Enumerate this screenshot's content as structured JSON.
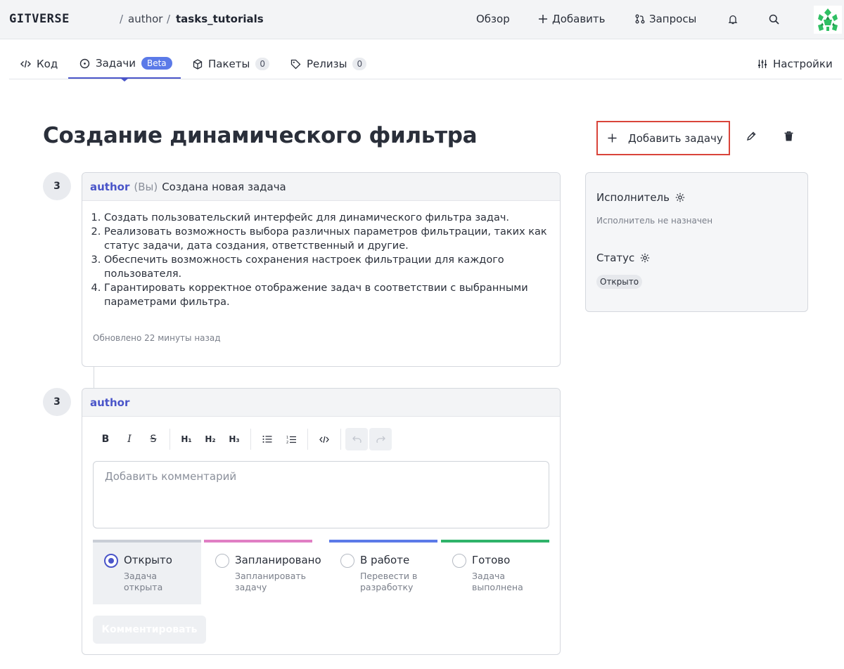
{
  "header": {
    "logo": "GITVERSE",
    "breadcrumb": {
      "owner": "author",
      "repo": "tasks_tutorials",
      "separator": "/"
    },
    "nav": [
      {
        "label": "Обзор",
        "icon": ""
      },
      {
        "label": "Добавить",
        "icon": "plus-icon"
      },
      {
        "label": "Запросы",
        "icon": "pull-request-icon"
      }
    ],
    "icons": [
      "bell-icon",
      "search-icon",
      "avatar"
    ]
  },
  "tabs": [
    {
      "label": "Код",
      "icon": "code-icon"
    },
    {
      "label": "Задачи",
      "icon": "issue-icon",
      "badge": "Beta",
      "active": true
    },
    {
      "label": "Пакеты",
      "icon": "package-icon",
      "badge": "0"
    },
    {
      "label": "Релизы",
      "icon": "tag-icon",
      "badge": "0"
    }
  ],
  "settings_label": "Настройки",
  "issue": {
    "title": "Создание динамического фильтра",
    "add_task_label": "Добавить задачу",
    "first_comment": {
      "step": "3",
      "author": "author",
      "you": "(Вы)",
      "action": "Создана новая задача",
      "items": [
        "Создать пользовательский интерфейс для динамического фильтра задач.",
        "Реализовать возможность выбора различных параметров фильтрации, таких как статус задачи, дата создания, ответственный и другие.",
        "Обеспечить возможность сохранения настроек фильтрации для каждого пользователя.",
        "Гарантировать корректное отображение задач в соответствии с выбранными параметрами фильтра."
      ],
      "updated": "Обновлено 22 минуты назад"
    },
    "new_comment": {
      "step": "3",
      "author": "author",
      "toolbar": [
        "B",
        "I",
        "S",
        "H1",
        "H2",
        "H3",
        "bullet-list",
        "ordered-list",
        "code",
        "undo",
        "redo"
      ],
      "placeholder": "Добавить комментарий",
      "statuses": [
        {
          "name": "Открыто",
          "desc": "Задача открыта",
          "color": "#c9ced6",
          "selected": true
        },
        {
          "name": "Запланировано",
          "desc": "Запланировать задачу",
          "color": "#e07fc4",
          "selected": false
        },
        {
          "name": "В работе",
          "desc": "Перевести в разработку",
          "color": "#5b7ae8",
          "selected": false
        },
        {
          "name": "Готово",
          "desc": "Задача выполнена",
          "color": "#2fb36a",
          "selected": false
        }
      ],
      "submit_label": "Комментировать"
    }
  },
  "sidebar": {
    "assignee_label": "Исполнитель",
    "assignee_value": "Исполнитель не назначен",
    "status_label": "Статус",
    "status_value": "Открыто"
  },
  "colors": {
    "accent": "#4a55c9",
    "beta": "#5b7ae8",
    "highlight": "#d9443a"
  }
}
